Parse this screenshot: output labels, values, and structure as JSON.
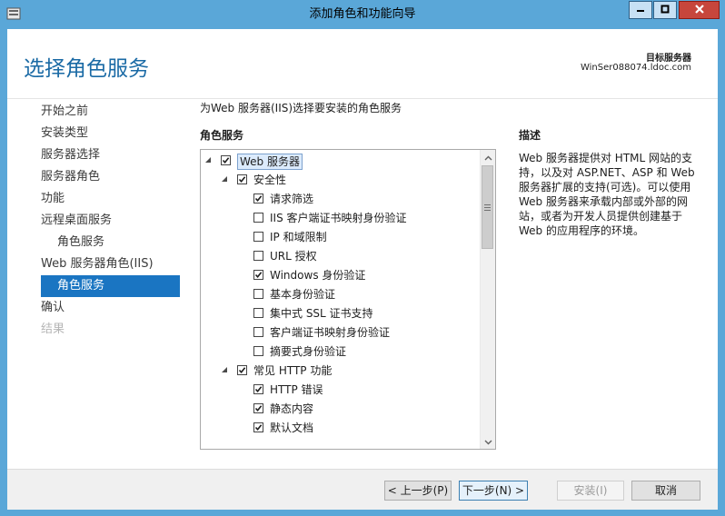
{
  "window": {
    "title": "添加角色和功能向导"
  },
  "header": {
    "page_title": "选择角色服务",
    "destination_label": "目标服务器",
    "destination_server": "WinSer088074.ldoc.com"
  },
  "nav": {
    "items": [
      {
        "label": "开始之前",
        "state": "normal"
      },
      {
        "label": "安装类型",
        "state": "normal"
      },
      {
        "label": "服务器选择",
        "state": "normal"
      },
      {
        "label": "服务器角色",
        "state": "normal"
      },
      {
        "label": "功能",
        "state": "normal"
      },
      {
        "label": "远程桌面服务",
        "state": "normal"
      },
      {
        "label": "角色服务",
        "state": "sub"
      },
      {
        "label": "Web 服务器角色(IIS)",
        "state": "normal"
      },
      {
        "label": "角色服务",
        "state": "active"
      },
      {
        "label": "确认",
        "state": "normal"
      },
      {
        "label": "结果",
        "state": "disabled"
      }
    ]
  },
  "content": {
    "instruction": "为Web 服务器(IIS)选择要安装的角色服务",
    "list_heading": "角色服务",
    "tree": [
      {
        "label": "Web 服务器",
        "checked": true,
        "expanded": true,
        "level": 0
      },
      {
        "label": "安全性",
        "checked": true,
        "expanded": true,
        "level": 1
      },
      {
        "label": "请求筛选",
        "checked": true,
        "level": 2
      },
      {
        "label": "IIS 客户端证书映射身份验证",
        "checked": false,
        "level": 2
      },
      {
        "label": "IP 和域限制",
        "checked": false,
        "level": 2
      },
      {
        "label": "URL 授权",
        "checked": false,
        "level": 2
      },
      {
        "label": "Windows 身份验证",
        "checked": true,
        "level": 2
      },
      {
        "label": "基本身份验证",
        "checked": false,
        "level": 2
      },
      {
        "label": "集中式 SSL 证书支持",
        "checked": false,
        "level": 2
      },
      {
        "label": "客户端证书映射身份验证",
        "checked": false,
        "level": 2
      },
      {
        "label": "摘要式身份验证",
        "checked": false,
        "level": 2
      },
      {
        "label": "常见 HTTP 功能",
        "checked": true,
        "expanded": true,
        "level": 1
      },
      {
        "label": "HTTP 错误",
        "checked": true,
        "level": 2
      },
      {
        "label": "静态内容",
        "checked": true,
        "level": 2
      },
      {
        "label": "默认文档",
        "checked": true,
        "level": 2
      }
    ]
  },
  "description": {
    "heading": "描述",
    "body": "Web 服务器提供对 HTML 网站的支持，以及对 ASP.NET、ASP 和 Web 服务器扩展的支持(可选)。可以使用 Web 服务器来承载内部或外部的网站，或者为开发人员提供创建基于 Web 的应用程序的环境。"
  },
  "footer": {
    "prev_label": "< 上一步(P)",
    "next_label": "下一步(N) >",
    "install_label": "安装(I)",
    "cancel_label": "取消"
  },
  "colors": {
    "accent": "#1a75c2",
    "title_blue": "#1a6aa5",
    "frame": "#5aa7d8",
    "close_red": "#c7463c"
  }
}
